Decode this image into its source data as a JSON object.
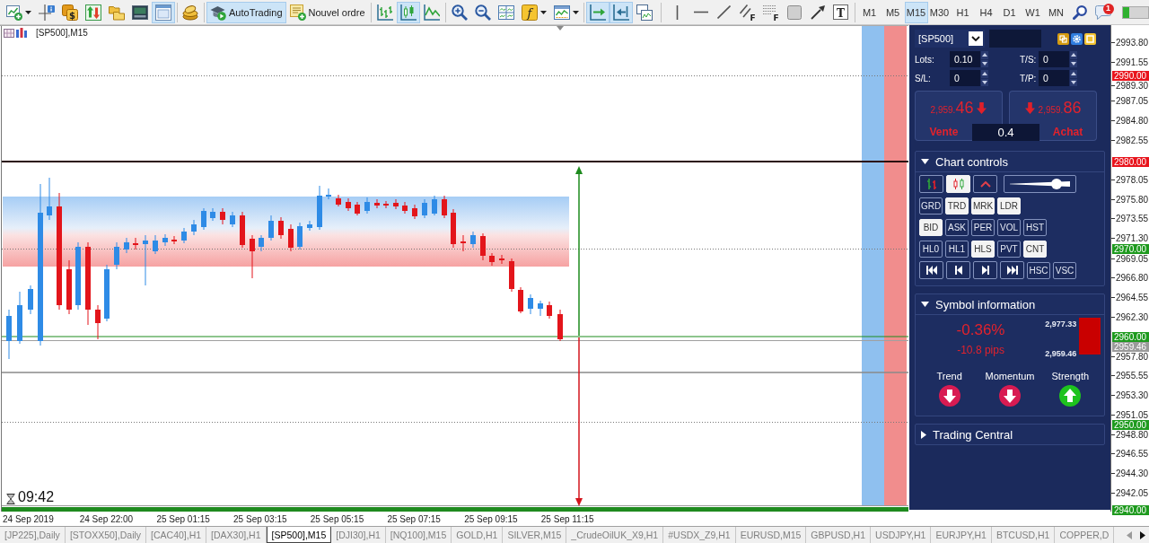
{
  "toolbar": {
    "groups": [
      [
        {
          "selected": false
        },
        {
          "selected": false
        },
        {
          "selected": false,
          "glyph": "$"
        },
        {
          "selected": false
        },
        {
          "selected": false
        },
        {
          "selected": false
        },
        {
          "selected": true
        }
      ],
      [
        {
          "selected": false
        }
      ],
      [
        {
          "label": "AutoTrading",
          "selected": true
        },
        {
          "label": "Nouvel ordre",
          "selected": false
        }
      ],
      [
        {
          "selected": false
        },
        {
          "selected": true
        },
        {
          "selected": false
        }
      ],
      [
        {
          "selected": false
        },
        {
          "selected": false
        },
        {
          "selected": false
        },
        {
          "selected": false,
          "glyph": "f"
        },
        {
          "selected": false
        }
      ],
      [
        {
          "selected": true
        },
        {
          "selected": true
        },
        {
          "selected": false
        }
      ],
      [
        {
          "selected": false
        },
        {
          "selected": false
        },
        {
          "selected": false
        },
        {
          "selected": false,
          "glyph": "F"
        },
        {
          "selected": false,
          "glyph": "F"
        },
        {
          "selected": false
        },
        {
          "selected": false
        },
        {
          "selected": false,
          "glyph": "T"
        }
      ]
    ],
    "timeframes": [
      {
        "label": "M1",
        "selected": false
      },
      {
        "label": "M5",
        "selected": false
      },
      {
        "label": "M15",
        "selected": true
      },
      {
        "label": "M30",
        "selected": false
      },
      {
        "label": "H1",
        "selected": false
      },
      {
        "label": "H4",
        "selected": false
      },
      {
        "label": "D1",
        "selected": false
      },
      {
        "label": "W1",
        "selected": false
      },
      {
        "label": "MN",
        "selected": false
      }
    ],
    "notification_badge": "1",
    "progress": {
      "level": 0.27
    }
  },
  "chart": {
    "title": "[SP500],M15",
    "countdown": "09:42",
    "price_ticks": [
      "2993.80",
      "2991.55",
      "2989.30",
      "2987.05",
      "2984.80",
      "2982.55",
      "2978.05",
      "2975.80",
      "2973.55",
      "2971.30",
      "2969.05",
      "2966.80",
      "2964.55",
      "2962.30",
      "2957.80",
      "2955.55",
      "2953.30",
      "2951.05",
      "2948.80",
      "2946.55",
      "2944.30",
      "2942.05"
    ],
    "price_markers": [
      {
        "label": "2990.00",
        "color": "#e8141c"
      },
      {
        "label": "2980.00",
        "color": "#e8141c"
      },
      {
        "label": "2970.00",
        "color": "#1e9a1e"
      },
      {
        "label": "2960.00",
        "color": "#1e9a1e"
      },
      {
        "label": "2959.46",
        "color": "#9a9a9a"
      },
      {
        "label": "2950.00",
        "color": "#1e9a1e"
      },
      {
        "label": "2940.00",
        "color": "#1e9a1e"
      }
    ],
    "time_labels": [
      "24 Sep 2019",
      "24 Sep 22:00",
      "25 Sep 01:15",
      "25 Sep 03:15",
      "25 Sep 05:15",
      "25 Sep 07:15",
      "25 Sep 09:15",
      "25 Sep 11:15"
    ]
  },
  "panel": {
    "symbol": "[SP500]",
    "fields": [
      {
        "label": "Lots:",
        "value": "0.10"
      },
      {
        "label": "T/S:",
        "value": "0"
      },
      {
        "label": "S/L:",
        "value": "0"
      },
      {
        "label": "T/P:",
        "value": "0"
      }
    ],
    "trade": [
      {
        "kind": "sell",
        "price_small": "2,959.",
        "price_large": "46",
        "falling": true,
        "label": "Vente"
      },
      {
        "kind": "buy",
        "price_small": "2,959.",
        "price_large": "86",
        "falling": true,
        "label": "Achat"
      }
    ],
    "spread": "0.4",
    "sections": [
      {
        "kind": "controls",
        "title": "Chart controls",
        "expanded": true,
        "rows": [
          [
            {
              "kind": "icon",
              "on": false
            },
            {
              "kind": "icon",
              "on": true
            },
            {
              "kind": "icon",
              "on": false
            },
            {
              "kind": "slider",
              "level": 0.77
            }
          ],
          [
            {
              "kind": "text",
              "label": "GRD",
              "on": false
            },
            {
              "kind": "text",
              "label": "TRD",
              "on": true
            },
            {
              "kind": "text",
              "label": "MRK",
              "on": true
            },
            {
              "kind": "text",
              "label": "LDR",
              "on": true
            }
          ],
          [
            {
              "kind": "text",
              "label": "BID",
              "on": true
            },
            {
              "kind": "text",
              "label": "ASK",
              "on": false
            },
            {
              "kind": "text",
              "label": "PER",
              "on": false
            },
            {
              "kind": "text",
              "label": "VOL",
              "on": false
            },
            {
              "kind": "text",
              "label": "HST",
              "on": false
            }
          ],
          [
            {
              "kind": "text",
              "label": "HL0",
              "on": false
            },
            {
              "kind": "text",
              "label": "HL1",
              "on": false
            },
            {
              "kind": "text",
              "label": "HLS",
              "on": true
            },
            {
              "kind": "text",
              "label": "PVT",
              "on": false
            },
            {
              "kind": "text",
              "label": "CNT",
              "on": true
            }
          ],
          [
            {
              "kind": "icon",
              "on": false
            },
            {
              "kind": "icon",
              "on": false
            },
            {
              "kind": "icon",
              "on": false
            },
            {
              "kind": "icon",
              "on": false
            },
            {
              "kind": "text",
              "label": "HSC",
              "on": false
            },
            {
              "kind": "text",
              "label": "VSC",
              "on": false
            }
          ]
        ]
      },
      {
        "kind": "info",
        "title": "Symbol information",
        "expanded": true,
        "change": "-0.36%",
        "pips": "-10.8 pips",
        "high": "2,977.33",
        "low": "2,959.46",
        "indicators": [
          {
            "label": "Trend",
            "kind": "down"
          },
          {
            "label": "Momentum",
            "kind": "down"
          },
          {
            "label": "Strength",
            "kind": "up"
          }
        ]
      },
      {
        "title": "Trading Central",
        "expanded": false
      }
    ]
  },
  "tabs": [
    {
      "label": "[JP225],Daily",
      "selected": false
    },
    {
      "label": "[STOXX50],Daily",
      "selected": false
    },
    {
      "label": "[CAC40],H1",
      "selected": false
    },
    {
      "label": "[DAX30],H1",
      "selected": false
    },
    {
      "label": "[SP500],M15",
      "selected": true
    },
    {
      "label": "[DJI30],H1",
      "selected": false
    },
    {
      "label": "[NQ100],M15",
      "selected": false
    },
    {
      "label": "GOLD,H1",
      "selected": false
    },
    {
      "label": "SILVER,M15",
      "selected": false
    },
    {
      "label": "_CrudeOilUK_X9,H1",
      "selected": false
    },
    {
      "label": "#USDX_Z9,H1",
      "selected": false
    },
    {
      "label": "EURUSD,M15",
      "selected": false
    },
    {
      "label": "GBPUSD,H1",
      "selected": false
    },
    {
      "label": "USDJPY,H1",
      "selected": false
    },
    {
      "label": "EURJPY,H1",
      "selected": false
    },
    {
      "label": "BTCUSD,H1",
      "selected": false
    },
    {
      "label": "COPPER,D",
      "selected": false
    }
  ]
}
